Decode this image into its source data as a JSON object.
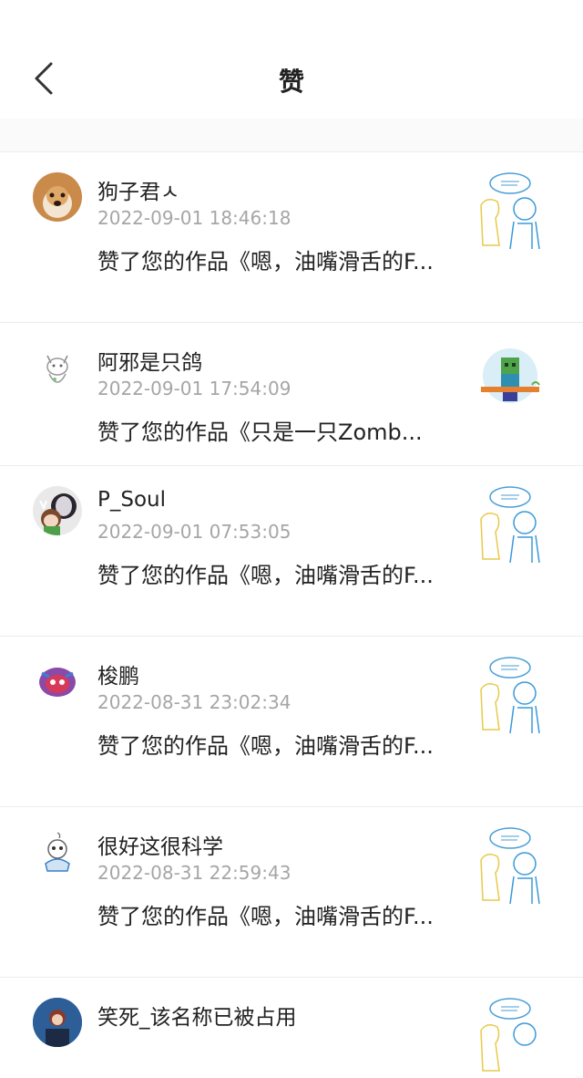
{
  "header": {
    "title": "赞"
  },
  "items": [
    {
      "name": "狗子君ㅅ",
      "time": "2022-09-01 18:46:18",
      "message": "赞了您的作品《嗯，油嘴滑舌的F...",
      "avatar": "dog-avatar-icon",
      "thumb": "sketch-artwork-icon"
    },
    {
      "name": "阿邪是只鸽",
      "time": "2022-09-01 17:54:09",
      "message": "赞了您的作品《只是一只Zomb...",
      "avatar": "cat-sketch-avatar-icon",
      "thumb": "zombie-artwork-icon"
    },
    {
      "name": "P_Soul",
      "time": "2022-09-01 07:53:05",
      "message": "赞了您的作品《嗯，油嘴滑舌的F...",
      "avatar": "anime-avatar-icon",
      "thumb": "sketch-artwork-icon"
    },
    {
      "name": "梭鹏",
      "time": "2022-08-31 23:02:34",
      "message": "赞了您的作品《嗯，油嘴滑舌的F...",
      "avatar": "robot-avatar-icon",
      "thumb": "sketch-artwork-icon"
    },
    {
      "name": "很好这很科学",
      "time": "2022-08-31 22:59:43",
      "message": "赞了您的作品《嗯，油嘴滑舌的F...",
      "avatar": "skeleton-avatar-icon",
      "thumb": "sketch-artwork-icon"
    },
    {
      "name": "笑死_该名称已被占用",
      "time": "",
      "message": "",
      "avatar": "person-avatar-icon",
      "thumb": "sketch-artwork-icon"
    }
  ]
}
